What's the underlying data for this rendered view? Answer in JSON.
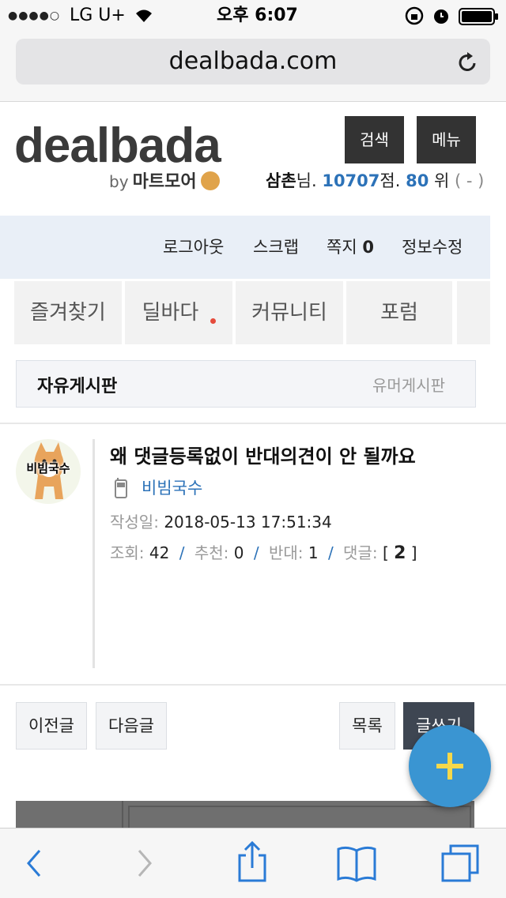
{
  "status_bar": {
    "carrier": "LG U+",
    "time": "오후 6:07"
  },
  "browser": {
    "url": "dealbada.com"
  },
  "header": {
    "logo_text": "dealbada",
    "logo_sub_by": "by",
    "logo_sub_brand": "마트모어",
    "search_label": "검색",
    "menu_label": "메뉴",
    "user": {
      "name": "삼촌",
      "suffix": "님.",
      "points": "10707",
      "points_unit": "점.",
      "rank": "80",
      "rank_unit": "위",
      "rank_change": "( - )"
    }
  },
  "login_bar": {
    "logout": "로그아웃",
    "scrap": "스크랩",
    "memo_label": "쪽지",
    "memo_count": "0",
    "edit_info": "정보수정"
  },
  "nav_tabs": [
    "즐겨찾기",
    "딜바다",
    "커뮤니티",
    "포럼"
  ],
  "board": {
    "title": "자유게시판",
    "other_board": "유머게시판"
  },
  "post": {
    "avatar_text": "비빔국수",
    "title": "왜 댓글등록없이 반대의견이 안 될까요",
    "author": "비빔국수",
    "date_label": "작성일:",
    "date_value": "2018-05-13 17:51:34",
    "views_label": "조회:",
    "views": "42",
    "recommend_label": "추천:",
    "recommend": "0",
    "oppose_label": "반대:",
    "oppose": "1",
    "comments_label": "댓글:",
    "comments": "2"
  },
  "actions": {
    "prev": "이전글",
    "next": "다음글",
    "list": "목록",
    "write": "글쓰기"
  },
  "colors": {
    "accent_blue": "#2c72b8",
    "fab_blue": "#3a95d2",
    "notice_red": "#e54b3c"
  }
}
